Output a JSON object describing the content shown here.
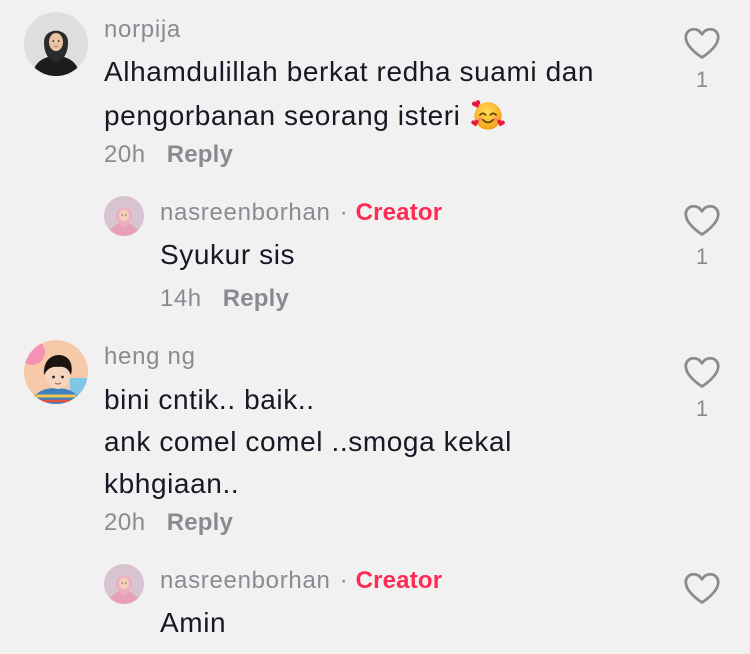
{
  "theme": {
    "background": "#f1f1f2",
    "text": "#161823",
    "muted": "#8a8b91",
    "creator": "#fe2c55"
  },
  "comments": [
    {
      "username": "norpija",
      "text": "Alhamdulillah berkat redha suami dan pengorbanan seorang isteri",
      "emoji": "smiling-face-with-hearts-emoji",
      "time": "20h",
      "reply_label": "Reply",
      "like_icon": "heart-outline-icon",
      "like_count": 1
    },
    {
      "username": "nasreenborhan",
      "separator": "·",
      "badge": "Creator",
      "text": "Syukur sis",
      "time": "14h",
      "reply_label": "Reply",
      "like_icon": "heart-outline-icon",
      "like_count": 1
    },
    {
      "username": "heng ng",
      "text": "bini cntik.. baik..\nank comel comel ..smoga kekal kbhgiaan..",
      "time": "20h",
      "reply_label": "Reply",
      "like_icon": "heart-outline-icon",
      "like_count": 1
    },
    {
      "username": "nasreenborhan",
      "separator": "·",
      "badge": "Creator",
      "text": "Amin",
      "like_icon": "heart-outline-icon"
    }
  ]
}
